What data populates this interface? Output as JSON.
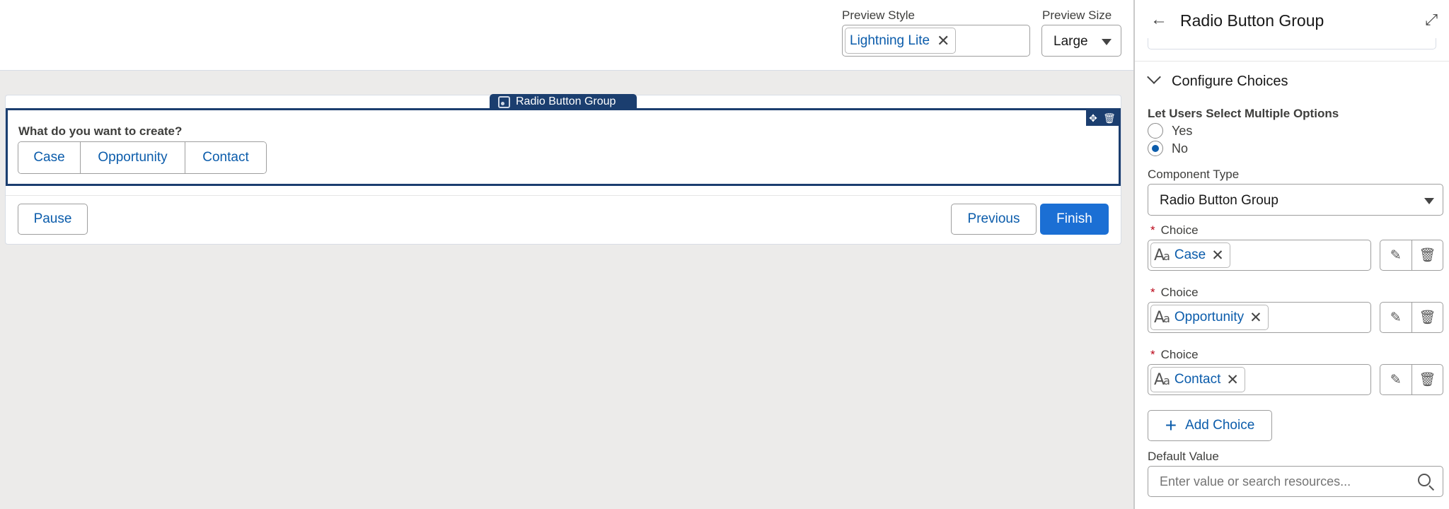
{
  "toolbar": {
    "preview_style_label": "Preview Style",
    "preview_style_value": "Lightning Lite",
    "preview_size_label": "Preview Size",
    "preview_size_value": "Large"
  },
  "canvas": {
    "component_tag": "Radio Button Group",
    "question": "What do you want to create?",
    "choices": [
      "Case",
      "Opportunity",
      "Contact"
    ],
    "buttons": {
      "pause": "Pause",
      "previous": "Previous",
      "finish": "Finish"
    }
  },
  "panel": {
    "title": "Radio Button Group",
    "section_title": "Configure Choices",
    "multi_select_label": "Let Users Select Multiple Options",
    "multi_select_options": [
      {
        "label": "Yes",
        "checked": false
      },
      {
        "label": "No",
        "checked": true
      }
    ],
    "component_type_label": "Component Type",
    "component_type_value": "Radio Button Group",
    "choice_label": "Choice",
    "required_mark": "*",
    "choice_values": [
      "Case",
      "Opportunity",
      "Contact"
    ],
    "add_choice_label": "Add Choice",
    "default_value_label": "Default Value",
    "default_value_placeholder": "Enter value or search resources..."
  },
  "colors": {
    "brand": "#1b6fd4",
    "link": "#0b5cab",
    "selection": "#1b3e6f",
    "required": "#ba0517"
  },
  "icons": [
    "close-icon",
    "chevron-down-icon",
    "back-arrow-icon",
    "expand-icon",
    "move-icon",
    "trash-icon",
    "text-template-icon",
    "pencil-icon",
    "plus-icon",
    "search-icon"
  ]
}
